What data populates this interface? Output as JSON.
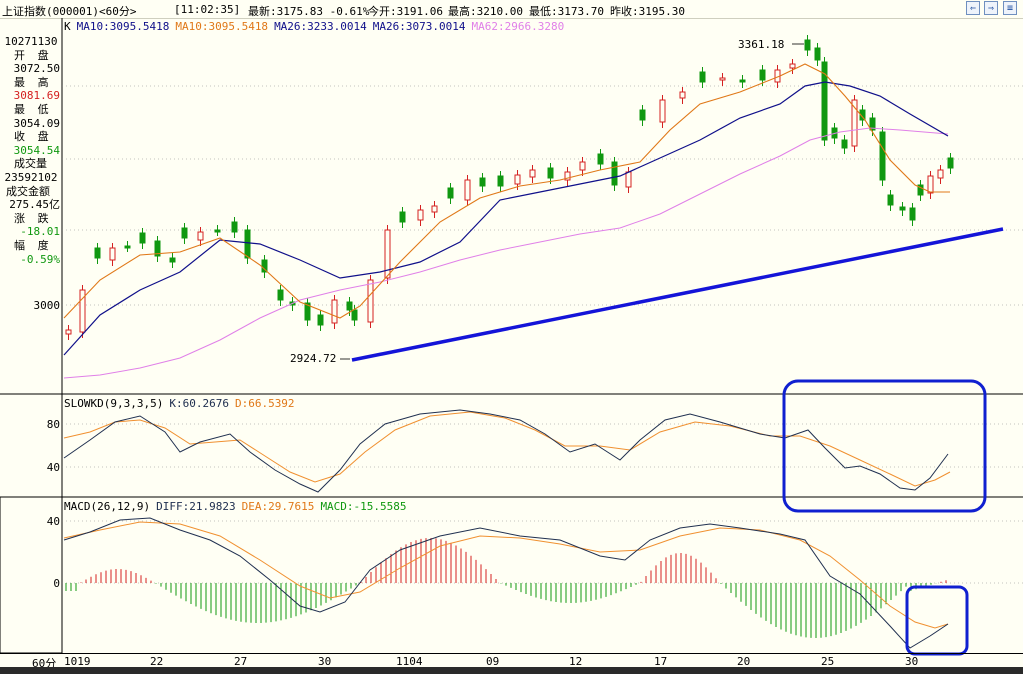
{
  "header": {
    "title": "上证指数",
    "code": "(000001)",
    "period": "<60分>",
    "time": "[11:02:35]",
    "latest_label": "最新:",
    "latest_value": "3175.83",
    "change_pct": "-0.61%",
    "open_label": "今开:",
    "open_value": "3191.06",
    "high_label": "最高:",
    "high_value": "3210.00",
    "low_label": "最低:",
    "low_value": "3173.70",
    "prev_label": "昨收:",
    "prev_value": "3195.30",
    "nav": [
      "⇐",
      "⇒",
      "≡"
    ]
  },
  "info_panel": {
    "date": "10271130",
    "open_label": "开 盘",
    "open": "3072.50",
    "high_label": "最 高",
    "high": "3081.69",
    "low_label": "最 低",
    "low": "3054.09",
    "close_label": "收 盘",
    "close": "3054.54",
    "volume_label": "成交量",
    "volume": "23592102",
    "amount_label": "成交金额",
    "amount": "275.45亿",
    "change_label": "涨 跌",
    "change": "-18.01",
    "pct_label": "幅 度",
    "pct": "-0.59%"
  },
  "main_legend": {
    "k": "K",
    "ma10a": "MA10:3095.5418",
    "ma10b": "MA10:3095.5418",
    "ma26a": "MA26:3233.0014",
    "ma26b": "MA26:3073.0014",
    "ma62": "MA62:2966.3280"
  },
  "kd_legend": {
    "name": "SLOWKD(9,3,3,5)",
    "k": "K:60.2676",
    "d": "D:66.5392"
  },
  "macd_legend": {
    "name": "MACD(26,12,9)",
    "diff": "DIFF:21.9823",
    "dea": "DEA:29.7615",
    "macd": "MACD:-15.5585"
  },
  "yticks": {
    "main": "3000",
    "kd_high": "80",
    "kd_low": "40",
    "macd_high": "40",
    "macd_zero": "0"
  },
  "x_labels": [
    "60分",
    "1019",
    "22",
    "27",
    "30",
    "1104",
    "09",
    "12",
    "17",
    "20",
    "25",
    "30"
  ],
  "annotations": {
    "high_label": "3361.18",
    "low_label": "2924.72"
  },
  "colors": {
    "up": "#D42020",
    "down": "#109810",
    "ma10": "#E07818",
    "ma26": "#10108A",
    "ma62": "#E080E8",
    "trendline": "#1414D8",
    "highlight": "#1020D0",
    "dea": "#F09030",
    "diff": "#203050"
  },
  "chart_data": [
    {
      "type": "candlestick",
      "title": "上证指数 60分",
      "annotations": {
        "high": 3361.18,
        "low": 2924.72
      },
      "series_names": [
        "MA10",
        "MA26",
        "MA62"
      ],
      "note_values": {
        "MA10": 3095.5418,
        "MA26": 3073.0014,
        "MA62": 2966.328
      }
    },
    {
      "type": "line",
      "title": "SLOWKD(9,3,3,5)",
      "series": [
        {
          "name": "K",
          "last": 60.2676
        },
        {
          "name": "D",
          "last": 66.5392
        }
      ],
      "yticks": [
        40,
        80
      ]
    },
    {
      "type": "bar",
      "title": "MACD(26,12,9)",
      "series": [
        {
          "name": "DIFF",
          "last": 21.9823
        },
        {
          "name": "DEA",
          "last": 29.7615
        },
        {
          "name": "MACD",
          "last": -15.5585
        }
      ],
      "yticks": [
        0,
        40
      ]
    }
  ]
}
